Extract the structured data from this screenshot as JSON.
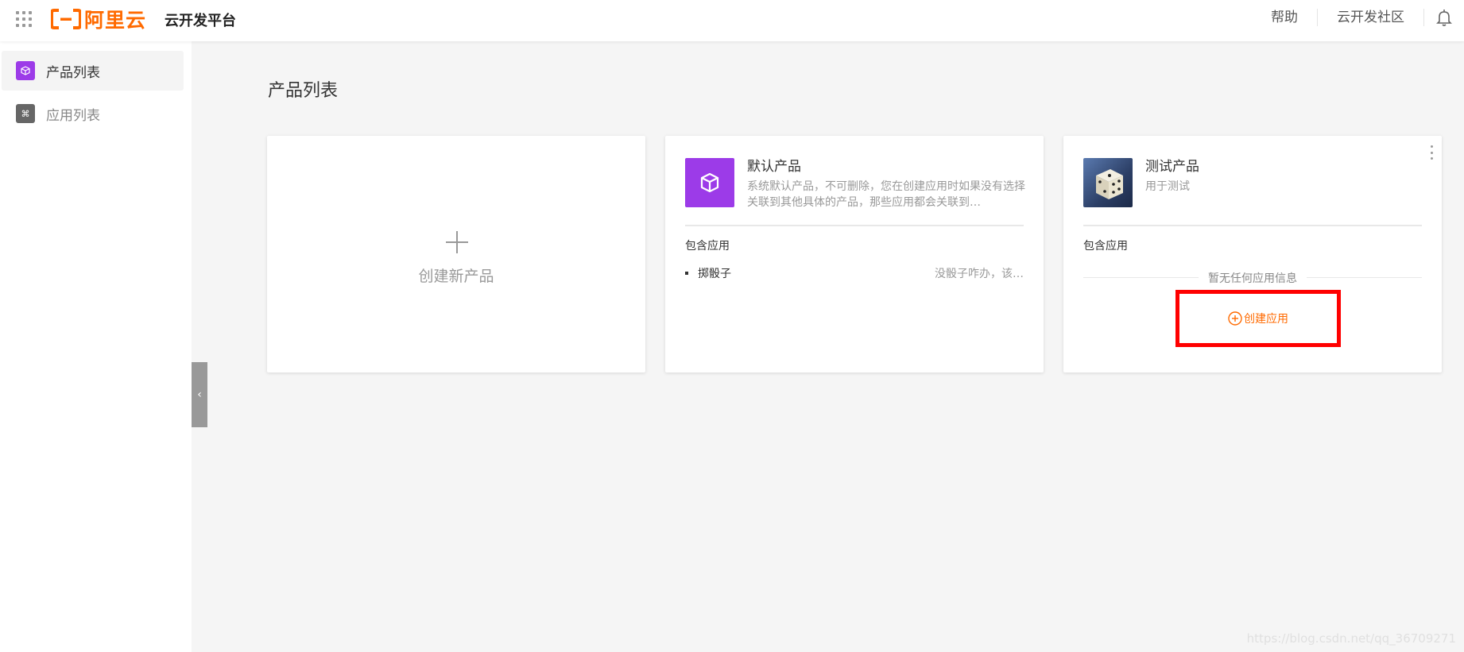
{
  "header": {
    "logo_text": "阿里云",
    "platform_title": "云开发平台",
    "nav": [
      "帮助",
      "云开发社区"
    ]
  },
  "sidebar": {
    "items": [
      {
        "label": "产品列表",
        "icon_color": "#9c3be8",
        "icon": "cube-icon",
        "active": true
      },
      {
        "label": "应用列表",
        "icon_color": "#666666",
        "icon": "command-icon",
        "active": false
      }
    ]
  },
  "main": {
    "title": "产品列表",
    "create_card": {
      "label": "创建新产品"
    },
    "products": [
      {
        "name": "默认产品",
        "description": "系统默认产品，不可删除，您在创建应用时如果没有选择关联到其他具体的产品，那些应用都会关联到…",
        "section_label": "包含应用",
        "apps": [
          {
            "name": "掷骰子",
            "desc": "没骰子咋办，该…"
          }
        ]
      },
      {
        "name": "测试产品",
        "description": "用于测试",
        "section_label": "包含应用",
        "empty_text": "暂无任何应用信息",
        "create_app_label": "创建应用"
      }
    ]
  },
  "watermark": "https://blog.csdn.net/qq_36709271",
  "colors": {
    "accent": "#ff6a00",
    "highlight_box": "#ff0000",
    "product_icon": "#9c3be8"
  }
}
